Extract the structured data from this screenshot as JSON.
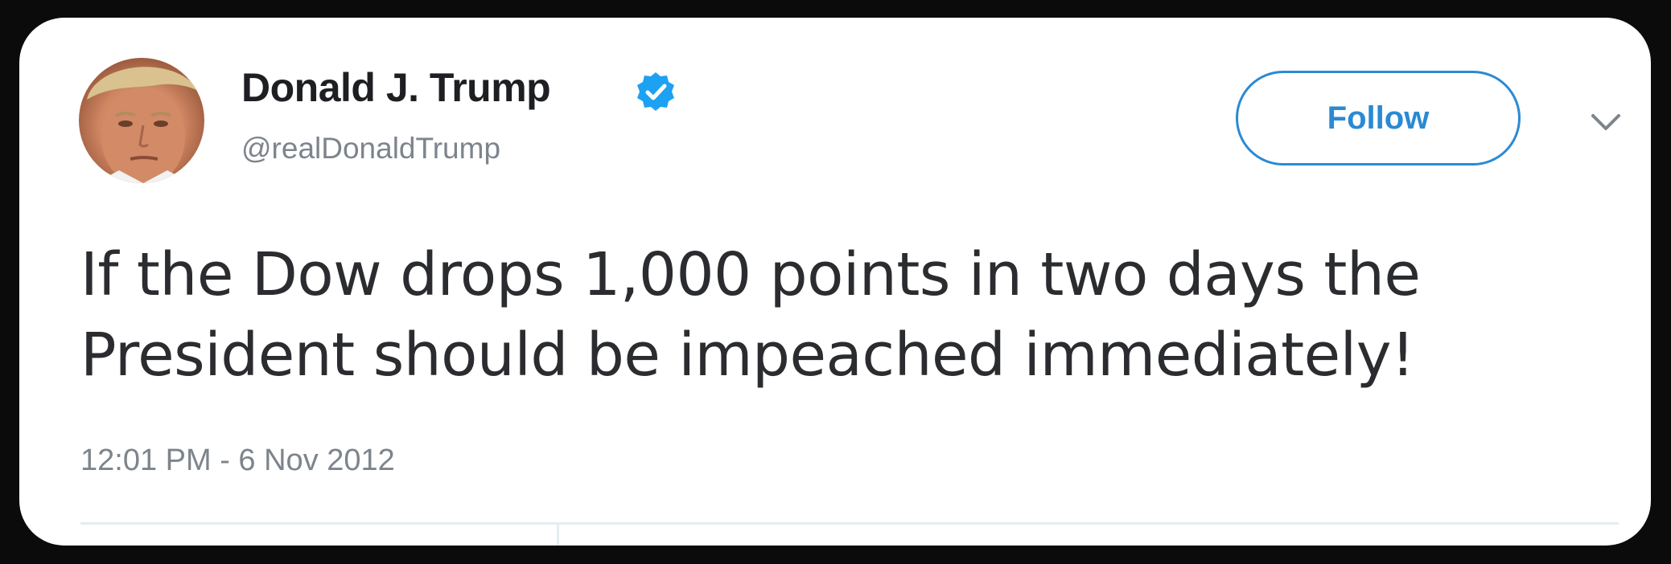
{
  "tweet": {
    "author": {
      "display_name": "Donald J. Trump",
      "handle": "@realDonaldTrump",
      "verified_icon": "verified-badge-icon",
      "avatar": "profile-photo"
    },
    "follow_label": "Follow",
    "text_lines": [
      "If the Dow drops 1,000 points in two days the",
      "President should be impeached immediately!"
    ],
    "timestamp": "12:01 PM - 6 Nov 2012",
    "menu_icon": "chevron-down-icon"
  },
  "colors": {
    "accent": "#2a8ad3",
    "verified": "#1da1f2",
    "text": "#2a2c2f",
    "secondary_text": "#7d848c",
    "background": "#ffffff",
    "frame": "#000000"
  }
}
